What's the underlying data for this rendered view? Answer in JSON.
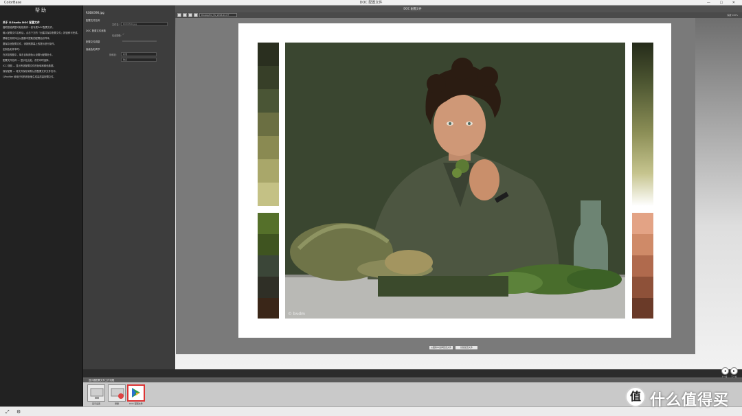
{
  "titlebar": {
    "app_name": "ColorBase",
    "window_title": "DOC 配置文件",
    "controls": "— ▢ ✕"
  },
  "help": {
    "title": "帮助",
    "heading": "关于 i1Studio DOC 配置文件",
    "paragraphs": [
      "借助智能调整可轻松制作一张专属DOC配置文件。",
      "输入配置文件名称后，点击下方的『创建并保存配置文件』按钮即可完成。",
      "屏幕左侧将列出从图像中提取的配置色彩样本。",
      "要保存此配置文件，请按照屏幕上的提示进行操作。",
      "定制色彩样本时：",
      "在浏览视图中，单击目标颜色以设置为配置色卡。",
      "配置文件名称 — 显示在此处，供打印时选择。",
      "ICC 视图 — 显示所选配置文件的色域和颜色数据。",
      "保存配置 — 将文件保存到默认的配置文件文件夹中。",
      "i1Profiler 使用已知的颜色值生成高质量配置文件。"
    ]
  },
  "settings": {
    "file_label": "ROD0390.jpg",
    "sec_config": "配置文件名称",
    "name_label": "文件名:",
    "name_value": "ROD0390.jpg",
    "sec_source": "DOC 配置文件参数",
    "opt_label": "包含图像:",
    "sec_smart": "配置文件调整",
    "sec_adv": "高级色彩调节",
    "sat_label": "饱和度:",
    "sat_value": "标准",
    "more_value": "较多"
  },
  "panel": {
    "title": "DOC 配置文件"
  },
  "toolbar": {
    "select_value": "DisplayPro_HL_2016-12-07",
    "right_text": "缩放 100%"
  },
  "colors": {
    "left_swatches": [
      "#2a2f1f",
      "#373f28",
      "#4a5535",
      "#6b6f42",
      "#8a8a52",
      "#a9a76a",
      "#c4c185"
    ],
    "left_swatches_bottom": [
      "#55702a",
      "#3f5420",
      "#3b4638",
      "#2f2f26",
      "#3a2618"
    ],
    "right_swatches_bottom": [
      "#e3a385",
      "#cf8a68",
      "#b06a4d",
      "#8e5139",
      "#6a3a28"
    ]
  },
  "photo": {
    "credit": "© bvdm"
  },
  "buttons": {
    "apply": "从图像中选择配置文件",
    "save": "创建配置文件"
  },
  "nav": {
    "back": "上一步",
    "next": "下一步"
  },
  "workflow": {
    "header": "显示器配置文件工作流程",
    "steps": [
      {
        "label": "显示设置"
      },
      {
        "label": "测量"
      },
      {
        "label": "DOC 配置文件"
      }
    ]
  },
  "watermark": {
    "logo": "值",
    "text": "什么值得买"
  }
}
